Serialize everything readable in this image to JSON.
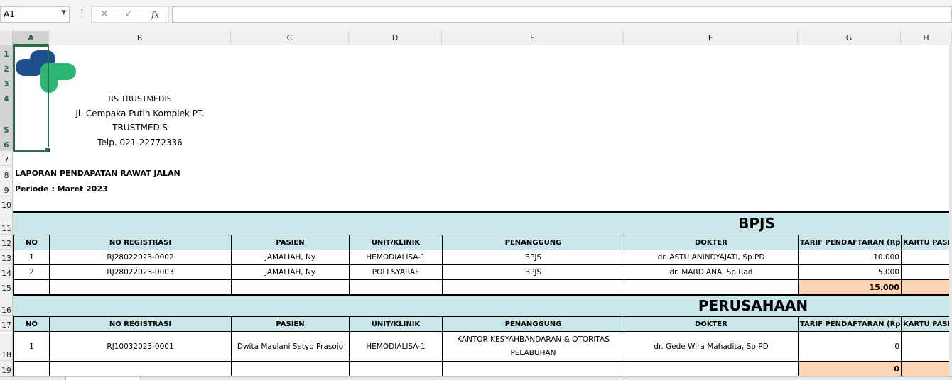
{
  "namebox": {
    "value": "A1"
  },
  "formula_bar": {
    "value": ""
  },
  "columns": [
    "A",
    "B",
    "C",
    "D",
    "E",
    "F",
    "G",
    "H"
  ],
  "rows": [
    "1",
    "2",
    "3",
    "4",
    "5",
    "6",
    "7",
    "8",
    "9",
    "10",
    "11",
    "12",
    "13",
    "14",
    "15",
    "16",
    "17",
    "18",
    "19"
  ],
  "hospital": {
    "name": "RS TRUSTMEDIS",
    "address1": "Jl. Cempaka Putih Komplek PT.",
    "address2": "TRUSTMEDIS",
    "phone": "Telp. 021-22772336"
  },
  "report": {
    "title": "LAPORAN PENDAPATAN RAWAT JALAN",
    "period": "Periode  : Maret 2023"
  },
  "headers": [
    "NO",
    "NO REGISTRASI",
    "PASIEN",
    "UNIT/KLINIK",
    "PENANGGUNG",
    "DOKTER",
    "TARIF PENDAFTARAN (Rp)",
    "KARTU PASIEN"
  ],
  "sections": [
    {
      "title": "BPJS",
      "rows": [
        [
          "1",
          "RJ28022023-0002",
          "JAMALIAH, Ny",
          "HEMODIALISA-1",
          "BPJS",
          "dr. ASTU ANINDYAJATI, Sp.PD",
          "10.000",
          ""
        ],
        [
          "2",
          "RJ28022023-0003",
          "JAMALIAH, Ny",
          "POLI SYARAF",
          "BPJS",
          "dr. MARDIANA. Sp.Rad",
          "5.000",
          ""
        ]
      ],
      "total": "15.000"
    },
    {
      "title": "PERUSAHAAN",
      "rows": [
        [
          "1",
          "RJ10032023-0001",
          "Dwita Maulani Setyo Prasojo",
          "HEMODIALISA-1",
          "KANTOR KESYAHBANDARAN & OTORITAS PELABUHAN",
          "dr. Gede Wira Mahadita, Sp.PD",
          "0",
          ""
        ]
      ],
      "total": "0"
    }
  ],
  "colors": {
    "band": "#c9e6ea",
    "total": "#fbd4b4",
    "selection": "#217346",
    "logo_blue": "#1f4e8c",
    "logo_green": "#2bb673"
  }
}
